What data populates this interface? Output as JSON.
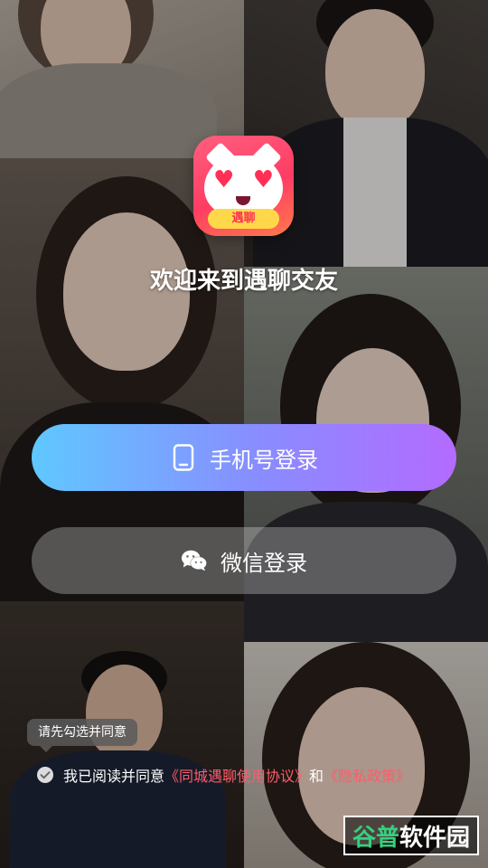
{
  "app": {
    "logo_text": "遇聊",
    "welcome": "欢迎来到遇聊交友"
  },
  "buttons": {
    "phone_login": {
      "label": "手机号登录",
      "icon": "phone-icon"
    },
    "wechat_login": {
      "label": "微信登录",
      "icon": "wechat-icon"
    }
  },
  "agreement": {
    "tooltip": "请先勾选并同意",
    "prefix": "我已阅读并同意",
    "user_agreement": "《同城遇聊使用协议》",
    "and": "和",
    "privacy_policy": "《隐私政策》",
    "checked": false
  },
  "watermark": {
    "part1": "谷普",
    "part2": "软件园"
  },
  "colors": {
    "brand_pink": "#ff3c64",
    "link_red": "#ff5c6c",
    "primary_gradient_start": "#5fc8ff",
    "primary_gradient_end": "#b36bff"
  }
}
